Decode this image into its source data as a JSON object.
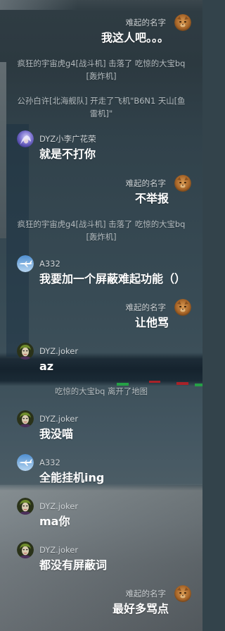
{
  "chat": {
    "messages": [
      {
        "self": true,
        "sender": "难起的名字",
        "avatar": "brown-photo-avatar",
        "text": "我这人吧。。。"
      },
      {
        "notice": "疯狂的宇宙虎g4[战斗机] 击落了 吃惊的大宝bq[轰炸机]"
      },
      {
        "notice": "公孙白许[北海舰队] 开走了飞机\"B6N1 天山[鱼雷机]\""
      },
      {
        "self": false,
        "sender": "DYZ小李广花荣",
        "avatar": "purple-anime-avatar",
        "text": "就是不打你"
      },
      {
        "self": true,
        "sender": "难起的名字",
        "avatar": "brown-photo-avatar",
        "text": "不举报"
      },
      {
        "notice": "疯狂的宇宙虎g4[战斗机] 击落了 吃惊的大宝bq[轰炸机]"
      },
      {
        "self": false,
        "sender": "A332",
        "avatar": "airplane-avatar",
        "text": "我要加一个屏蔽难起功能（）"
      },
      {
        "self": true,
        "sender": "难起的名字",
        "avatar": "brown-photo-avatar",
        "text": "让他骂"
      },
      {
        "self": false,
        "sender": "DYZ.joker",
        "avatar": "joker-avatar",
        "text": "az"
      },
      {
        "notice": "吃惊的大宝bq 离开了地图"
      },
      {
        "self": false,
        "sender": "DYZ.joker",
        "avatar": "joker-avatar",
        "text": "我没喵"
      },
      {
        "self": false,
        "sender": "A332",
        "avatar": "airplane-avatar",
        "text": "全能挂机ing"
      },
      {
        "self": false,
        "sender": "DYZ.joker",
        "avatar": "joker-avatar",
        "text": "ma你"
      },
      {
        "self": false,
        "sender": "DYZ.joker",
        "avatar": "joker-avatar",
        "text": "都没有屏蔽词"
      },
      {
        "self": true,
        "sender": "难起的名字",
        "avatar": "brown-photo-avatar",
        "text": "最好多骂点"
      }
    ]
  },
  "colors": {
    "message_text": "#ffffff",
    "sender_name": "#cdd2d5",
    "notice_text": "#b5bdc1",
    "kill_marker_green": "#25a046",
    "kill_marker_red": "#a82228"
  }
}
